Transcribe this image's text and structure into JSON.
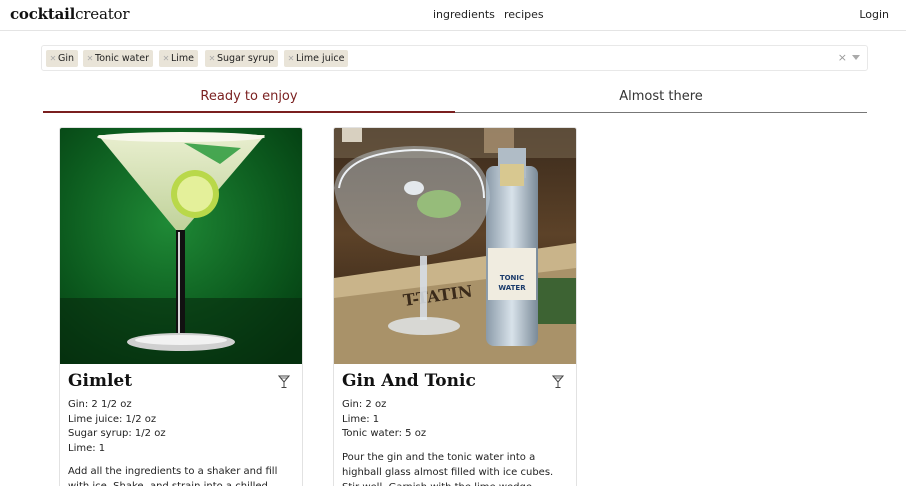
{
  "header": {
    "logo_bold": "cocktail",
    "logo_rest": "creator",
    "nav": [
      "ingredients",
      "recipes"
    ],
    "login": "Login"
  },
  "selector": {
    "tags": [
      "Gin",
      "Tonic water",
      "Lime",
      "Sugar syrup",
      "Lime juice"
    ],
    "clear": "×"
  },
  "tabs": [
    "Ready to enjoy",
    "Almost there"
  ],
  "colors": {
    "accent": "#7a1f1f",
    "tag_bg": "#e9e4d8"
  },
  "cards": [
    {
      "title": "Gimlet",
      "icon": "cocktail-glass-icon",
      "ingredients": [
        "Gin: 2 1/2 oz",
        "Lime juice: 1/2 oz",
        "Sugar syrup: 1/2 oz",
        "Lime: 1"
      ],
      "instructions": "Add all the ingredients to a shaker and fill with ice. Shake, and strain into a chilled"
    },
    {
      "title": "Gin And Tonic",
      "icon": "cocktail-glass-icon",
      "ingredients": [
        "Gin: 2 oz",
        "Lime: 1",
        "Tonic water: 5 oz"
      ],
      "instructions": "Pour the gin and the tonic water into a highball glass almost filled with ice cubes. Stir well. Garnish with the lime wedge."
    }
  ]
}
